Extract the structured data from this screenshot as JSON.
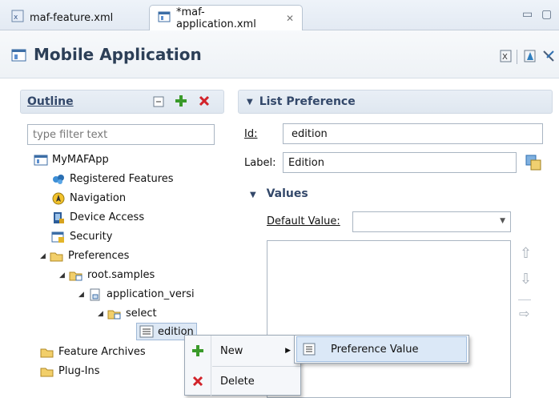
{
  "tabs": [
    {
      "label": "maf-feature.xml"
    },
    {
      "label": "*maf-application.xml"
    }
  ],
  "header": {
    "title": "Mobile Application"
  },
  "outline": {
    "title": "Outline",
    "filter_placeholder": "type filter text",
    "tree": {
      "root": "MyMAFApp",
      "registered_features": "Registered Features",
      "navigation": "Navigation",
      "device_access": "Device Access",
      "security": "Security",
      "preferences": "Preferences",
      "root_samples": "root.samples",
      "application_version": "application_versi",
      "select": "select",
      "edition": "edition",
      "feature_archives": "Feature Archives",
      "plug_ins": "Plug-Ins"
    }
  },
  "list_preference": {
    "title": "List Preference",
    "id_label": "Id:",
    "id_value": "edition",
    "label_label": "Label:",
    "label_value": "Edition",
    "values_title": "Values",
    "default_value_label": "Default Value:",
    "default_value": ""
  },
  "context_menu": {
    "new_label": "New",
    "delete_label": "Delete"
  },
  "submenu": {
    "preference_value_label": "Preference Value"
  },
  "colors": {
    "accent": "#33486a",
    "delete": "#d2232a",
    "add": "#3a9a2a"
  }
}
